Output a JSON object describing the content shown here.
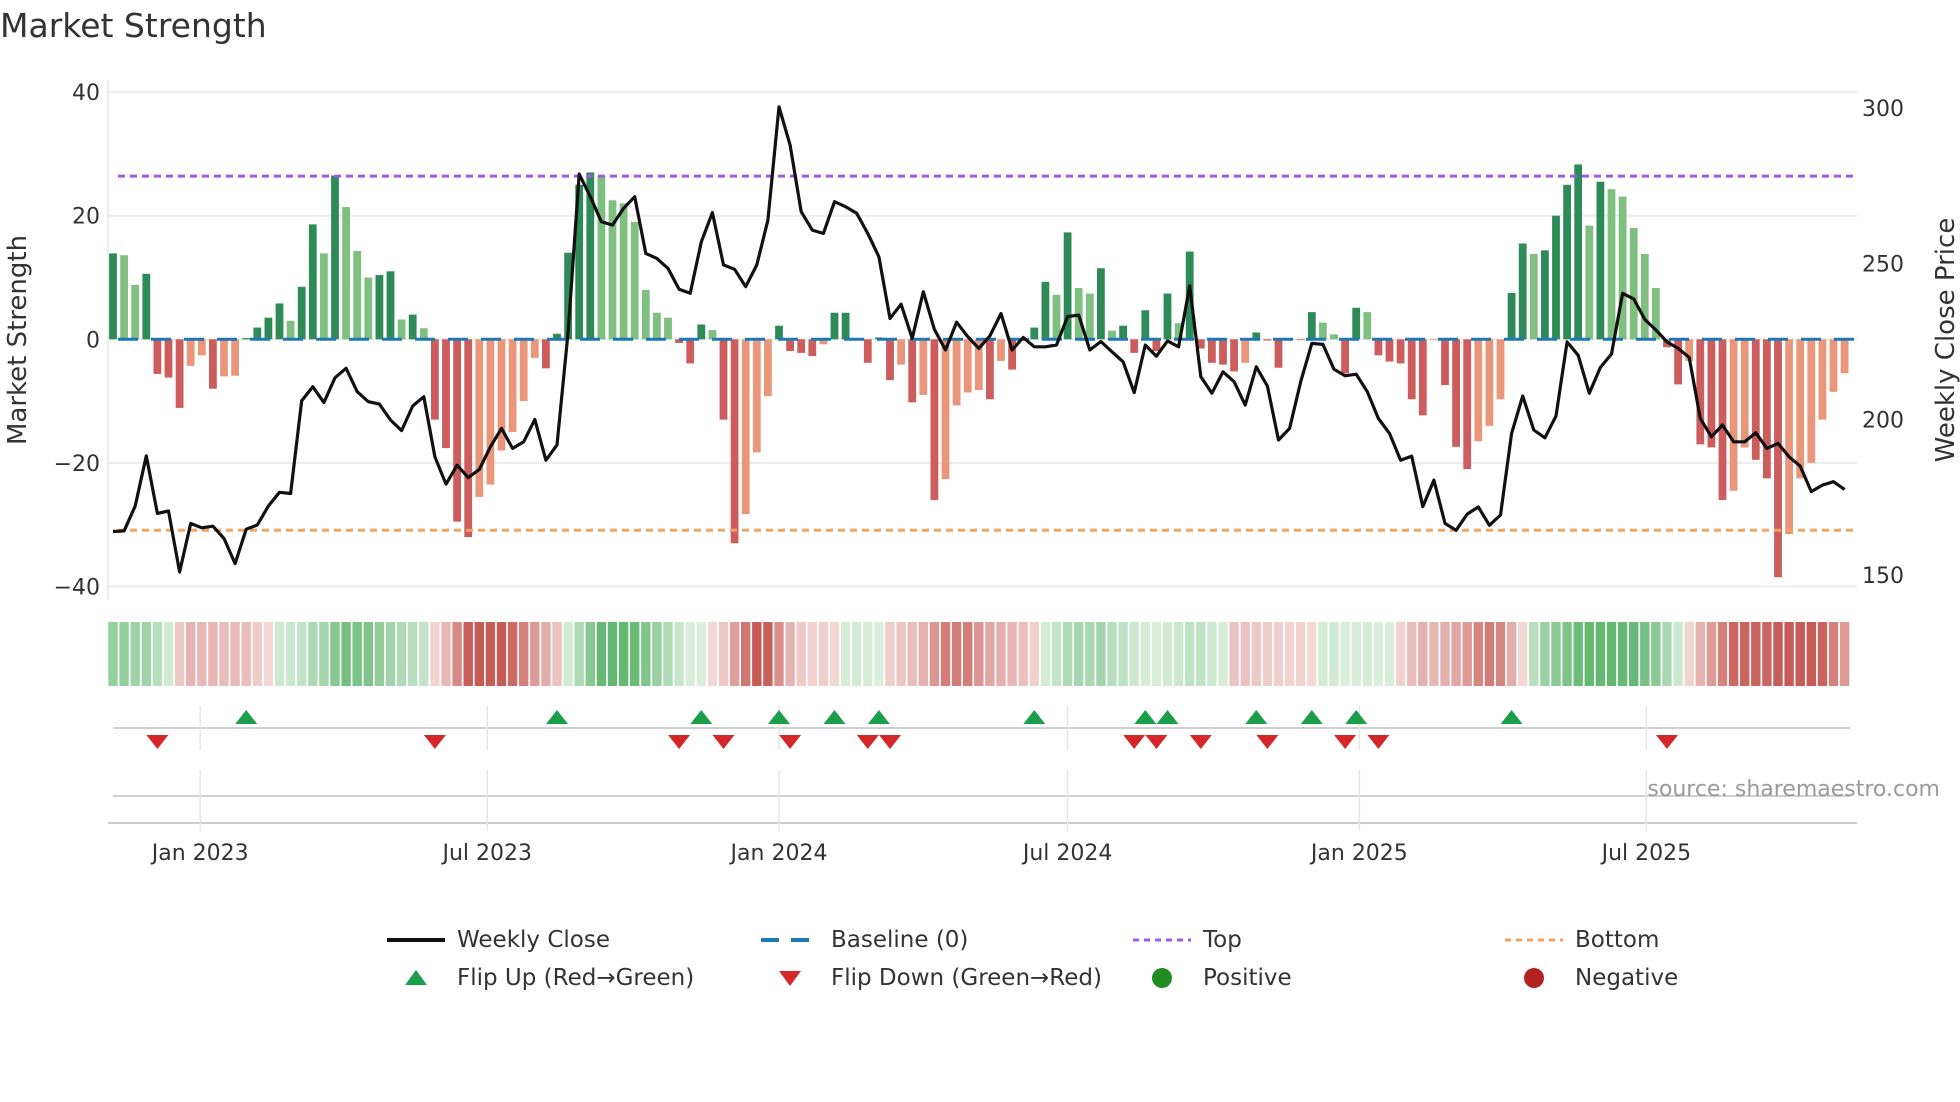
{
  "title": "Market Strength",
  "source": "source: sharemaestro.com",
  "colors": {
    "bar_pos_strong": "#2e8b57",
    "bar_pos_weak": "#7fbf7f",
    "bar_neg_strong": "#cd5c5c",
    "bar_neg_weak": "#e9967a",
    "band_pos": "#5cb56b",
    "band_neg": "#c4524c",
    "price_line": "#111111",
    "baseline": "#1f77b4",
    "top": "#9b5de5",
    "bottom": "#f4a261",
    "flip_up": "#1a9e4a",
    "flip_down": "#d62728",
    "positive": "#228b22",
    "negative": "#b22222"
  },
  "chart_data": {
    "type": "bar",
    "title": "Market Strength",
    "x_frequency": "weekly",
    "x_start": "2022-11-07",
    "x_ticks": [
      {
        "label": "Jan 2023",
        "date": "2023-01-01"
      },
      {
        "label": "Jul 2023",
        "date": "2023-07-01"
      },
      {
        "label": "Jan 2024",
        "date": "2024-01-01"
      },
      {
        "label": "Jul 2024",
        "date": "2024-07-01"
      },
      {
        "label": "Jan 2025",
        "date": "2025-01-01"
      },
      {
        "label": "Jul 2025",
        "date": "2025-07-01"
      }
    ],
    "ylabel": "Market Strength",
    "ylim": [
      -42,
      42
    ],
    "yticks": [
      {
        "v": 40,
        "label": "40"
      },
      {
        "v": 20,
        "label": "20"
      },
      {
        "v": 0,
        "label": "0"
      },
      {
        "v": -20,
        "label": "−20"
      },
      {
        "v": -40,
        "label": "−40"
      }
    ],
    "y2label": "Weekly Close Price",
    "y2ticks": [
      {
        "v": 300,
        "label": "300"
      },
      {
        "v": 250,
        "label": "250"
      },
      {
        "v": 200,
        "label": "200"
      },
      {
        "v": 150,
        "label": "150"
      }
    ],
    "top_level": 26.4,
    "bottom_level": -30.9,
    "baseline": 0,
    "grid": true,
    "legend_position": "bottom",
    "strength": [
      13.9,
      13.6,
      8.8,
      10.6,
      -5.6,
      -6.2,
      -11.1,
      -4.3,
      -2.6,
      -8,
      -6,
      -5.9,
      0.2,
      1.9,
      3.5,
      5.8,
      3,
      8.5,
      18.6,
      13.9,
      26.5,
      21.4,
      14.3,
      10,
      10.4,
      11,
      3.2,
      4,
      1.8,
      -13,
      -17.6,
      -29.5,
      -32,
      -25.5,
      -23.5,
      -18,
      -15,
      -10,
      -3,
      -4.7,
      0.9,
      14,
      25,
      27,
      26.5,
      22.5,
      22,
      19,
      8,
      4.3,
      3.5,
      -0.6,
      -3.9,
      2.4,
      1.5,
      -13,
      -33,
      -28.3,
      -18.3,
      -9.2,
      2.2,
      -1.9,
      -2.2,
      -2.7,
      -0.8,
      4.3,
      4.3,
      0.2,
      -3.8,
      0.3,
      -6.6,
      -4.1,
      -10.2,
      -9,
      -26,
      -22.6,
      -10.7,
      -8.6,
      -8.2,
      -9.7,
      -3.5,
      -4.9,
      0,
      1.9,
      9.3,
      7.2,
      17.3,
      8.3,
      7.4,
      11.5,
      1.4,
      2.2,
      -2.2,
      4.7,
      -1.9,
      7.4,
      2.6,
      14.2,
      -1.5,
      -3.8,
      -4.1,
      -5.2,
      -3.8,
      1.1,
      -0.2,
      -4.6,
      -0.1,
      -0.1,
      4.4,
      2.7,
      0.8,
      -5.5,
      5.1,
      4.4,
      -2.6,
      -3.6,
      -3.9,
      -9.7,
      -12.3,
      -0.1,
      -7.4,
      -17.4,
      -21,
      -16.5,
      -14,
      -9.7,
      7.5,
      15.5,
      13.8,
      14.4,
      20,
      25,
      28.3,
      18.4,
      25.5,
      24.3,
      23.1,
      18,
      13.8,
      8.3,
      -1.3,
      -7.3,
      -3.5,
      -17,
      -17.5,
      -26,
      -24.5,
      -17.5,
      -19.5,
      -22.5,
      -38.5,
      -31.5,
      -22.5,
      -20,
      -13,
      -8.5,
      -5.5
    ],
    "weekly_close": [
      164,
      164.2,
      172.2,
      188.3,
      169.8,
      170.6,
      151,
      166.6,
      165.2,
      165.7,
      161.8,
      153.7,
      164.7,
      166.1,
      172.2,
      176.6,
      176.2,
      206,
      210.5,
      205.4,
      213.4,
      216.4,
      208.9,
      205.7,
      204.9,
      199.8,
      196.4,
      204.3,
      207.3,
      188,
      179.2,
      185.3,
      181.3,
      183.9,
      191.2,
      197.1,
      190.7,
      192.8,
      200,
      186.9,
      191.8,
      228,
      278.8,
      271.5,
      263.5,
      262.4,
      267.8,
      271.5,
      253.3,
      251.7,
      248.5,
      241.8,
      240.5,
      257,
      266.4,
      249.6,
      248.2,
      242.6,
      249.6,
      264,
      300.4,
      288.1,
      266.7,
      260.8,
      259.7,
      269.9,
      268.3,
      266.2,
      259.7,
      252.2,
      232.4,
      237,
      226,
      241,
      228.9,
      222.3,
      231.2,
      226.6,
      222.8,
      226.8,
      234,
      222.3,
      226.3,
      223.3,
      223.3,
      223.9,
      233,
      233.5,
      222.3,
      225,
      221.7,
      218.5,
      208.6,
      223.9,
      220.3,
      225.2,
      223.3,
      242.9,
      213.7,
      208.4,
      215.3,
      212.1,
      204.6,
      216.9,
      210.7,
      193.4,
      197.1,
      212.1,
      224.4,
      224.1,
      216.1,
      214,
      214.5,
      208.9,
      200.3,
      195.5,
      186.9,
      188.2,
      172,
      180.5,
      166.6,
      164.4,
      169.6,
      171.9,
      166,
      169.3,
      195.5,
      207.5,
      196.6,
      194.1,
      201.1,
      224.9,
      220.6,
      208.4,
      216.7,
      221,
      240.5,
      238.7,
      232.1,
      228.7,
      224.9,
      222.8,
      219.9,
      200.3,
      194.4,
      198.2,
      192.8,
      192.8,
      195.7,
      190.7,
      192.3,
      188,
      185,
      176.8,
      178.9,
      180,
      177.5
    ],
    "flip_up_weeks": [
      12,
      40,
      53,
      60,
      65,
      69,
      83,
      93,
      95,
      103,
      108,
      112,
      126
    ],
    "flip_down_weeks": [
      4,
      29,
      51,
      55,
      61,
      68,
      70,
      92,
      94,
      98,
      104,
      111,
      114,
      140
    ]
  },
  "legend": {
    "weekly_close": "Weekly Close",
    "baseline": "Baseline (0)",
    "top": "Top",
    "bottom": "Bottom",
    "flip_up": "Flip Up (Red→Green)",
    "flip_down": "Flip Down (Green→Red)",
    "positive": "Positive",
    "negative": "Negative"
  }
}
